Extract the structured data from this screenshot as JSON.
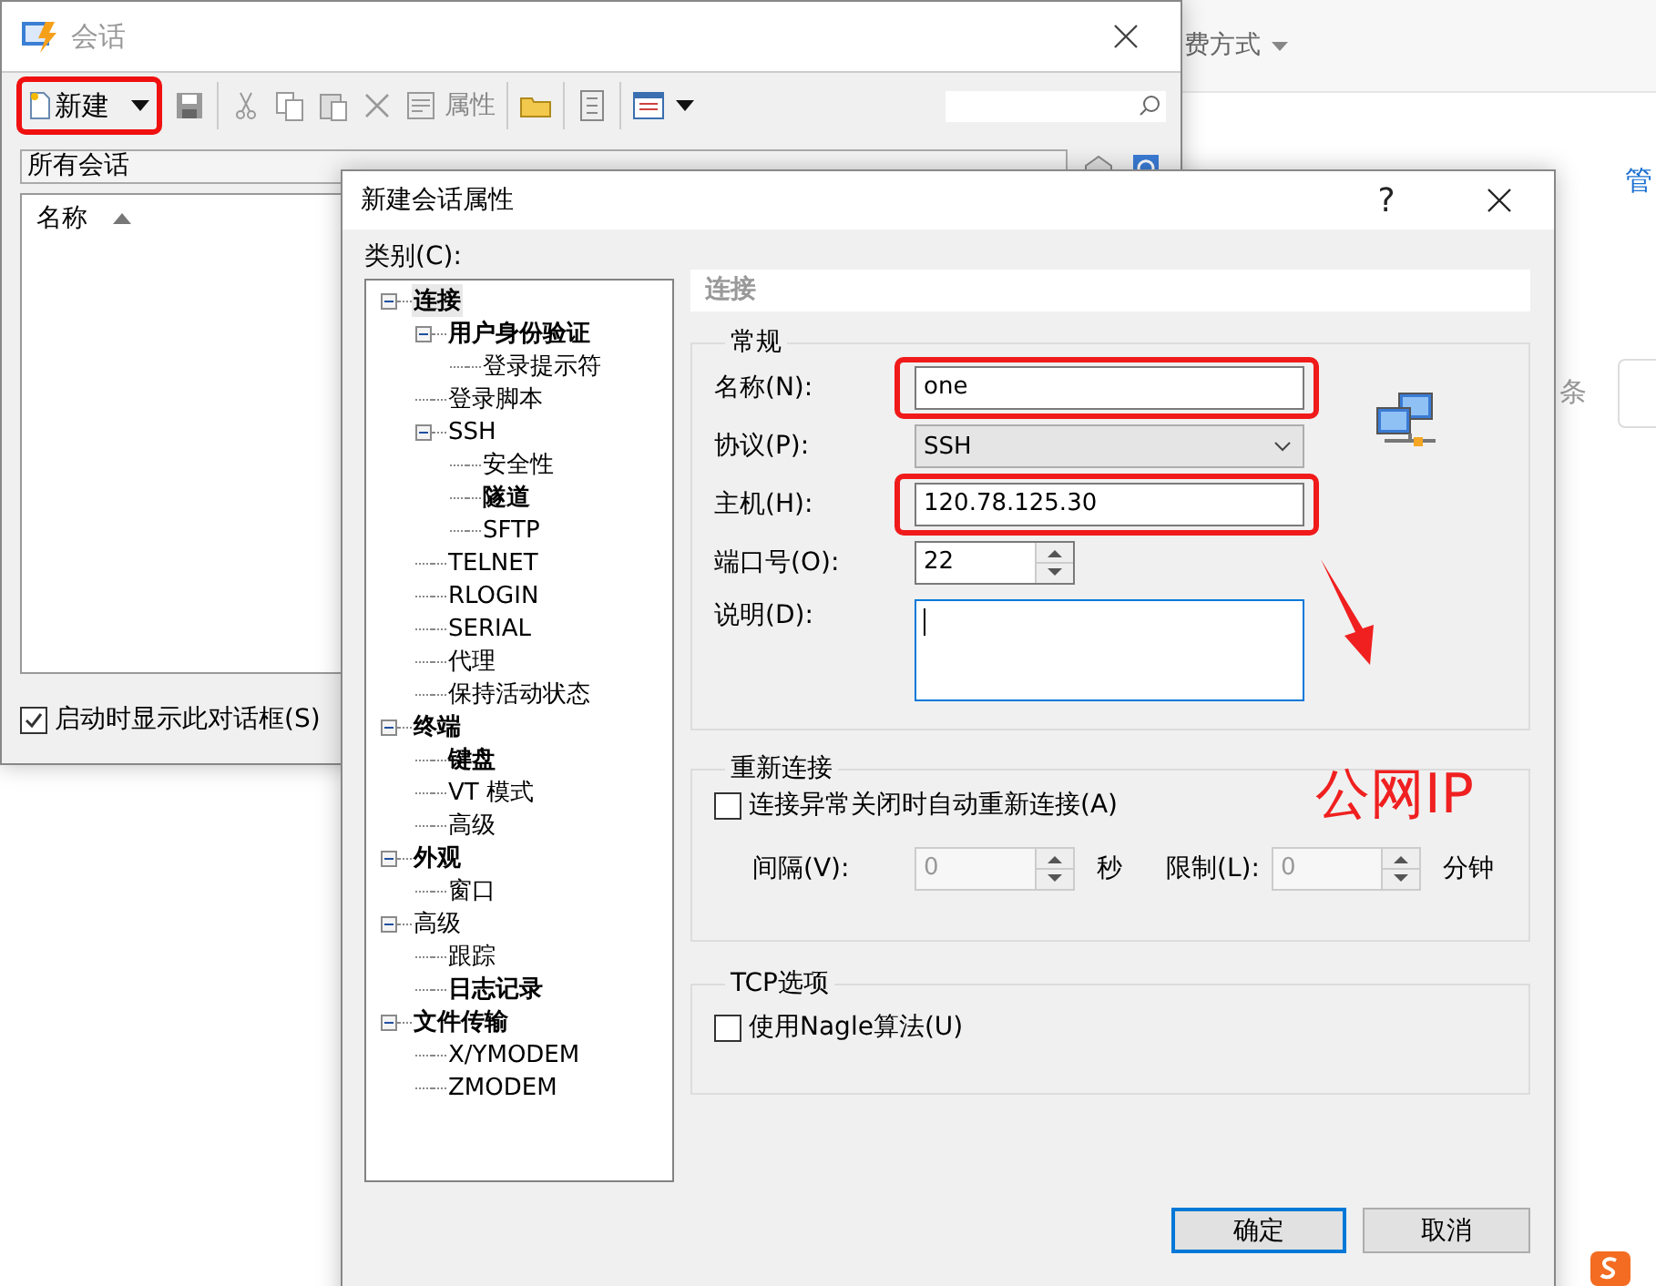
{
  "background_page": {
    "menu_text": "费方式",
    "link_text": "管",
    "side_text": "条"
  },
  "session_window": {
    "title": "会话",
    "toolbar": {
      "new_button": {
        "label": "新建",
        "highlighted": true
      },
      "properties_button": "属性"
    },
    "folder_path": "所有会话",
    "list": {
      "column": "名称"
    },
    "startup_checkbox": {
      "label": "启动时显示此对话框(S)",
      "checked": true
    }
  },
  "dialog": {
    "title": "新建会话属性",
    "help": "?",
    "category_label": "类别(C):",
    "tree": [
      {
        "label": "连接",
        "bold": true,
        "selected": true,
        "expanded": true,
        "children": [
          {
            "label": "用户身份验证",
            "bold": true,
            "selected": false,
            "expanded": true,
            "children": [
              {
                "label": "登录提示符",
                "bold": false,
                "selected": false
              }
            ]
          },
          {
            "label": "登录脚本",
            "bold": false,
            "selected": false
          },
          {
            "label": "SSH",
            "bold": false,
            "selected": false,
            "expanded": true,
            "children": [
              {
                "label": "安全性",
                "bold": false,
                "selected": false
              },
              {
                "label": "隧道",
                "bold": true,
                "selected": false
              },
              {
                "label": "SFTP",
                "bold": false,
                "selected": false
              }
            ]
          },
          {
            "label": "TELNET",
            "bold": false,
            "selected": false
          },
          {
            "label": "RLOGIN",
            "bold": false,
            "selected": false
          },
          {
            "label": "SERIAL",
            "bold": false,
            "selected": false
          },
          {
            "label": "代理",
            "bold": false,
            "selected": false
          },
          {
            "label": "保持活动状态",
            "bold": false,
            "selected": false
          }
        ]
      },
      {
        "label": "终端",
        "bold": true,
        "selected": false,
        "expanded": true,
        "children": [
          {
            "label": "键盘",
            "bold": true,
            "selected": false
          },
          {
            "label": "VT 模式",
            "bold": false,
            "selected": false
          },
          {
            "label": "高级",
            "bold": false,
            "selected": false
          }
        ]
      },
      {
        "label": "外观",
        "bold": true,
        "selected": false,
        "expanded": true,
        "children": [
          {
            "label": "窗口",
            "bold": false,
            "selected": false
          }
        ]
      },
      {
        "label": "高级",
        "bold": false,
        "selected": false,
        "expanded": true,
        "children": [
          {
            "label": "跟踪",
            "bold": false,
            "selected": false
          },
          {
            "label": "日志记录",
            "bold": true,
            "selected": false
          }
        ]
      },
      {
        "label": "文件传输",
        "bold": true,
        "selected": false,
        "expanded": true,
        "children": [
          {
            "label": "X/YMODEM",
            "bold": false,
            "selected": false
          },
          {
            "label": "ZMODEM",
            "bold": false,
            "selected": false
          }
        ]
      }
    ],
    "section_title": "连接",
    "general": {
      "title": "常规",
      "fields": [
        {
          "kind": "text",
          "label": "名称(N):",
          "value": "one",
          "highlighted": true
        },
        {
          "kind": "select",
          "label": "协议(P):",
          "value": "SSH",
          "highlighted": false
        },
        {
          "kind": "text",
          "label": "主机(H):",
          "value": "120.78.125.30",
          "highlighted": true
        },
        {
          "kind": "spin",
          "label": "端口号(O):",
          "value": "22",
          "highlighted": false
        },
        {
          "kind": "memo",
          "label": "说明(D):",
          "highlighted": false
        }
      ]
    },
    "reconnect": {
      "title": "重新连接",
      "checkbox": {
        "label": "连接异常关闭时自动重新连接(A)",
        "checked": false
      },
      "interval": {
        "label": "间隔(V):",
        "value": "0",
        "unit": "秒",
        "disabled": true
      },
      "limit": {
        "label": "限制(L):",
        "value": "0",
        "unit": "分钟",
        "disabled": true
      }
    },
    "tcp": {
      "title": "TCP选项",
      "checkbox": {
        "label": "使用Nagle算法(U)",
        "checked": false
      }
    },
    "buttons": [
      {
        "label": "确定",
        "default": true
      },
      {
        "label": "取消",
        "default": false
      }
    ]
  },
  "annotation": {
    "text": "公网IP"
  }
}
